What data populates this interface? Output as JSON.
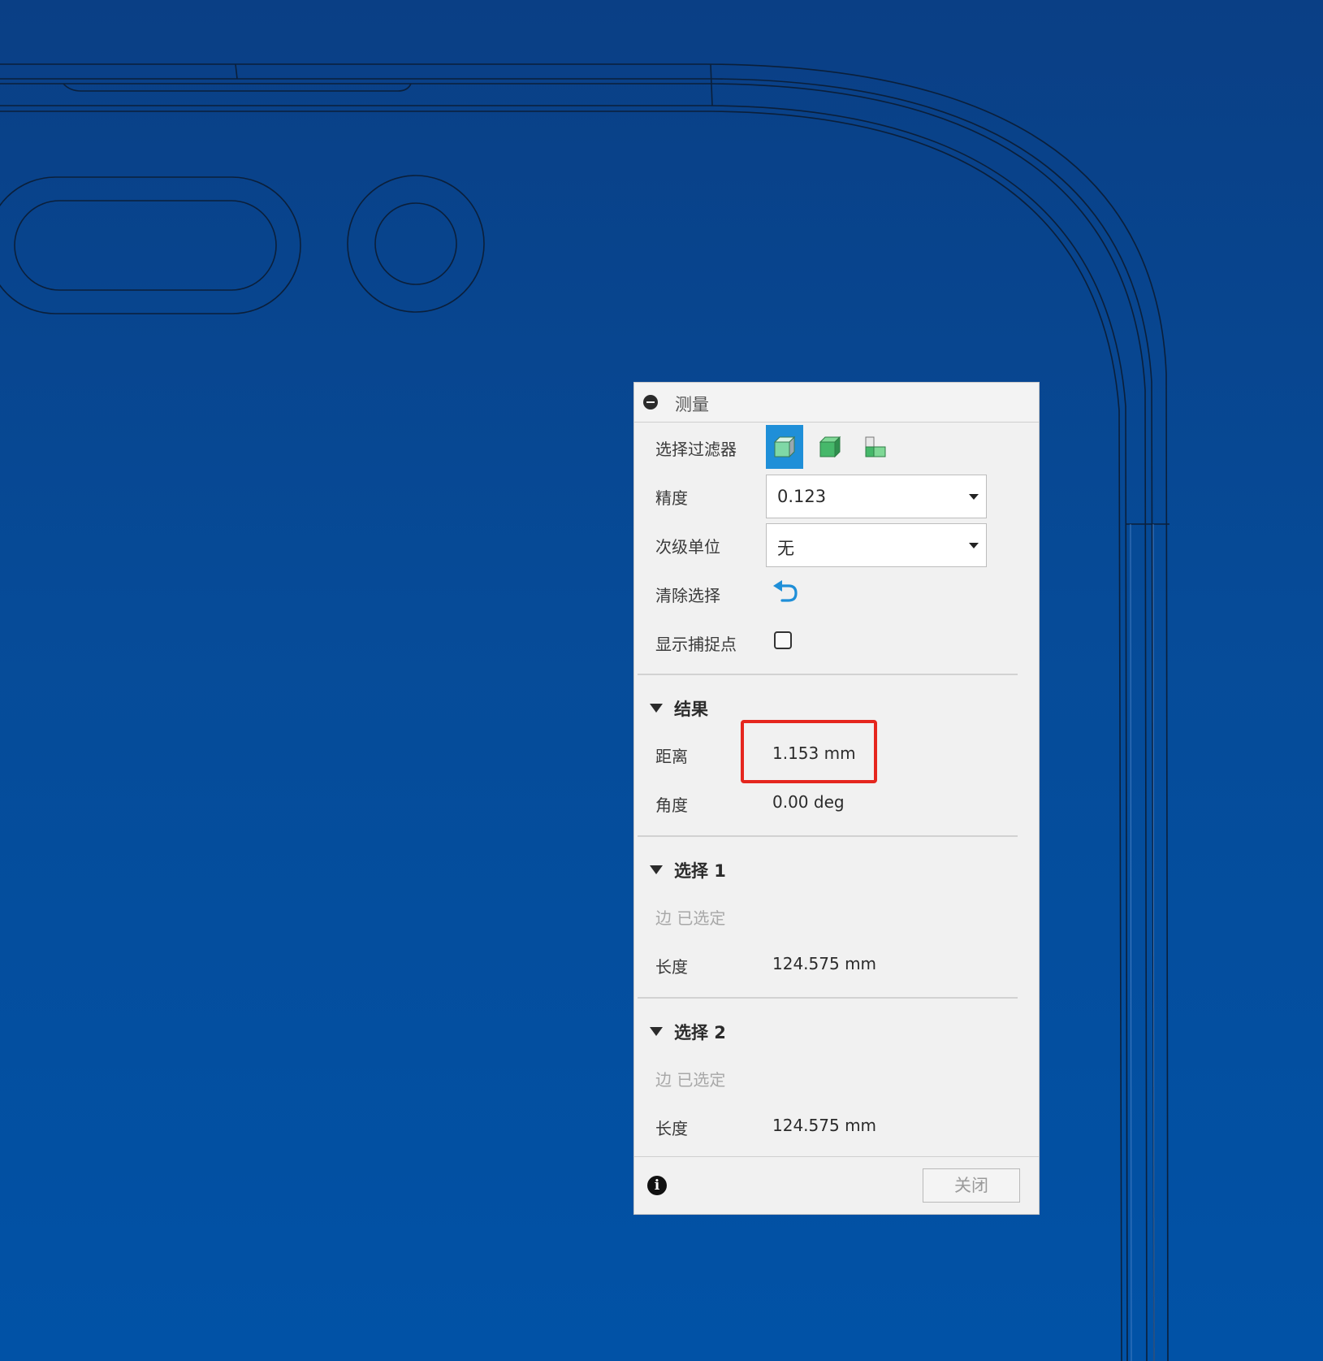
{
  "panel": {
    "title": "测量",
    "selection_filter": {
      "label": "选择过滤器",
      "buttons": [
        "body-filter",
        "face-filter",
        "edge-vertex-filter"
      ],
      "active": "body-filter"
    },
    "precision": {
      "label": "精度",
      "value": "0.123"
    },
    "secondary_units": {
      "label": "次级单位",
      "value": "无"
    },
    "clear_selection": {
      "label": "清除选择"
    },
    "show_snap_points": {
      "label": "显示捕捉点",
      "checked": false
    }
  },
  "results": {
    "title": "结果",
    "distance_label": "距离",
    "distance_value": "1.153 mm",
    "angle_label": "角度",
    "angle_value": "0.00 deg"
  },
  "selection1": {
    "title": "选择 1",
    "selected_text": "边 已选定",
    "length_label": "长度",
    "length_value": "124.575 mm"
  },
  "selection2": {
    "title": "选择 2",
    "selected_text": "边 已选定",
    "length_label": "长度",
    "length_value": "124.575 mm"
  },
  "footer": {
    "close_label": "关闭"
  },
  "colors": {
    "viewport_background": "#064b98",
    "accent": "#1f8fd8",
    "highlight": "#e5261e"
  }
}
